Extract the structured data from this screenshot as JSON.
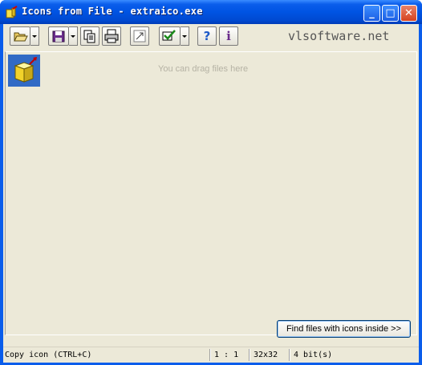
{
  "window": {
    "title": "Icons from File - extraico.exe",
    "controls": {
      "minimize": "_",
      "maximize": "□",
      "close": "✕"
    }
  },
  "toolbar": {
    "brand": "vlsoftware.net",
    "buttons": [
      {
        "name": "open-icon"
      },
      {
        "name": "save-icon"
      },
      {
        "name": "copy-icon"
      },
      {
        "name": "print-icon"
      },
      {
        "name": "resize-icon"
      },
      {
        "name": "checkmark-icon"
      },
      {
        "name": "help-icon",
        "glyph": "?"
      },
      {
        "name": "info-icon",
        "glyph": "i"
      }
    ]
  },
  "content": {
    "hint": "You can drag files here"
  },
  "find_button": "Find files with icons inside >>",
  "status": {
    "action": "Copy icon (CTRL+C)",
    "ratio": "1 : 1",
    "size": "32x32",
    "depth": "4 bit(s)"
  },
  "colors": {
    "titlebar": "#0054E3",
    "face": "#ECE9D8",
    "selection": "#316AC5",
    "help": "#1E5AC8",
    "info": "#6A2C8C"
  }
}
